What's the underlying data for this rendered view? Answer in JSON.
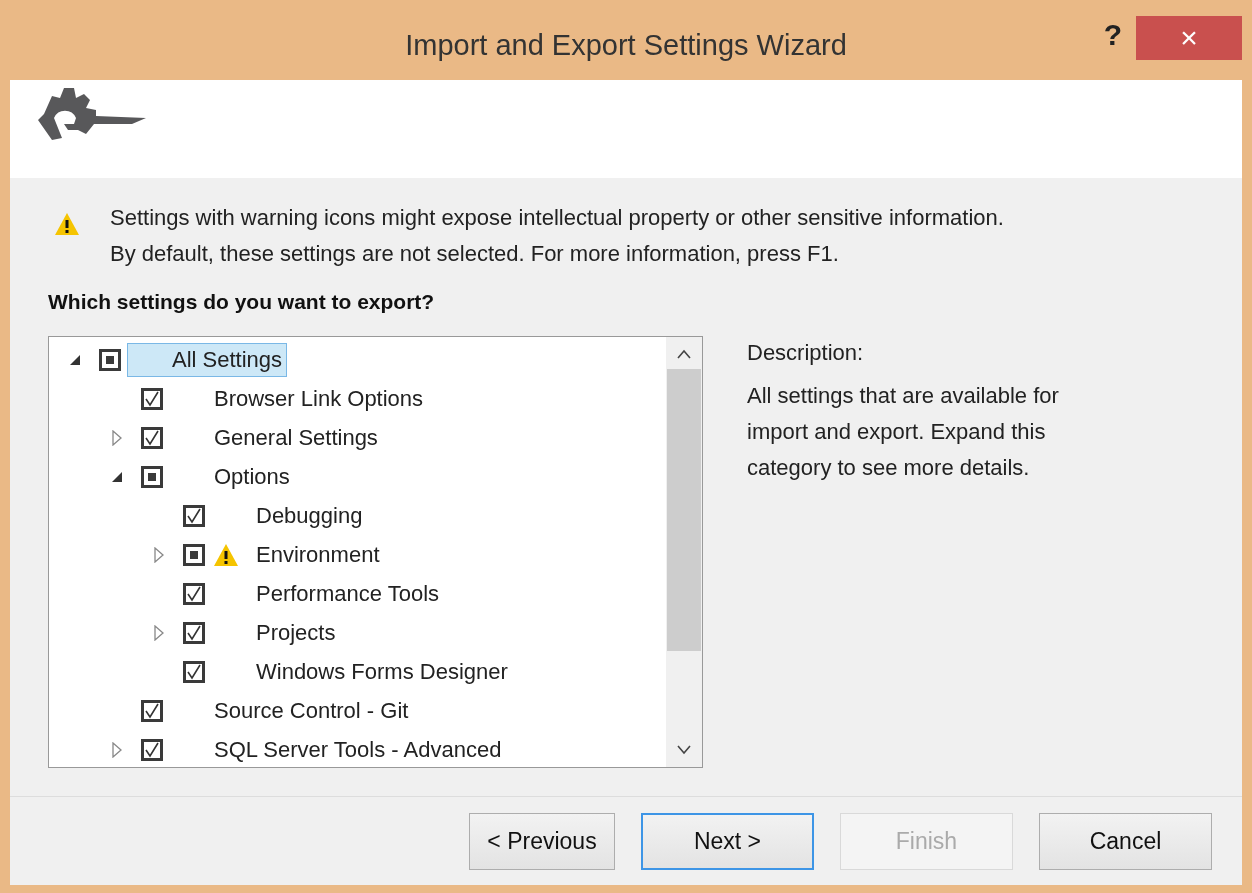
{
  "window": {
    "title": "Import and Export Settings Wizard",
    "help": "?",
    "close": "×"
  },
  "warning": {
    "lines": [
      "Settings with warning icons might expose intellectual property or other sensitive information.",
      "By default, these settings are not selected. For more information, press F1."
    ]
  },
  "question": "Which settings do you want to export?",
  "tree": [
    {
      "label": "All Settings",
      "indeterminate": true,
      "expanded": true,
      "selected": true,
      "warning": false,
      "children": [
        {
          "label": "Browser Link Options",
          "checked": true,
          "indeterminate": false,
          "selected": false,
          "warning": false
        },
        {
          "label": "General Settings",
          "checked": true,
          "indeterminate": false,
          "expanded": false,
          "selected": false,
          "warning": false
        },
        {
          "label": "Options",
          "indeterminate": true,
          "expanded": true,
          "selected": false,
          "warning": false,
          "children": [
            {
              "label": "Debugging",
              "checked": true,
              "indeterminate": false,
              "selected": false,
              "warning": false
            },
            {
              "label": "Environment",
              "indeterminate": true,
              "expanded": false,
              "selected": false,
              "warning": true
            },
            {
              "label": "Performance Tools",
              "checked": true,
              "indeterminate": false,
              "selected": false,
              "warning": false
            },
            {
              "label": "Projects",
              "checked": true,
              "indeterminate": false,
              "expanded": false,
              "selected": false,
              "warning": false
            },
            {
              "label": "Windows Forms Designer",
              "checked": true,
              "indeterminate": false,
              "selected": false,
              "warning": false
            }
          ]
        },
        {
          "label": "Source Control - Git",
          "checked": true,
          "indeterminate": false,
          "selected": false,
          "warning": false
        },
        {
          "label": "SQL Server Tools - Advanced",
          "checked": true,
          "indeterminate": false,
          "expanded": false,
          "selected": false,
          "warning": false
        }
      ]
    }
  ],
  "description": {
    "label": "Description:",
    "text": "All settings that are available for import and export. Expand this category to see more details."
  },
  "buttons": [
    {
      "label": "< Previous",
      "default": false,
      "disabled": false
    },
    {
      "label": "Next >",
      "default": true,
      "disabled": false
    },
    {
      "label": "Finish",
      "default": false,
      "disabled": true
    },
    {
      "label": "Cancel",
      "default": false,
      "disabled": false
    }
  ]
}
